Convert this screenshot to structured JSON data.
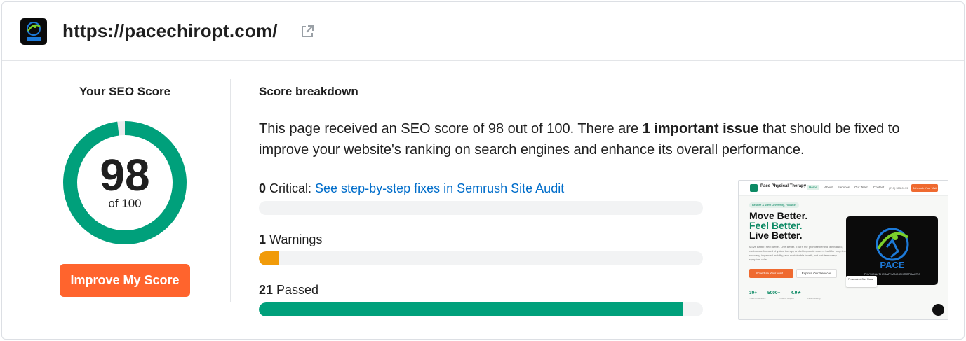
{
  "site": {
    "url": "https://pacechiropt.com/"
  },
  "score_panel": {
    "title": "Your SEO Score",
    "score": 98,
    "score_text": "98",
    "out_of_text": "of 100",
    "max": 100,
    "improve_button": "Improve My Score",
    "ring_color": "#00a07b",
    "button_color": "#ff642d"
  },
  "breakdown": {
    "title": "Score breakdown",
    "summary": {
      "pre": "This page received an SEO score of 98 out of 100. There are ",
      "bold": "1 important issue",
      "post": " that should be fixed to improve your website's ranking on search engines and enhance its overall performance."
    },
    "metrics": [
      {
        "count": "0",
        "label": " Critical: ",
        "link": "See step-by-step fixes in Semrush Site Audit",
        "fill_fraction": 0.0,
        "color": "#e5483b"
      },
      {
        "count": "1",
        "label": " Warnings",
        "link": "",
        "fill_fraction": 0.045,
        "color": "#f19b09"
      },
      {
        "count": "21",
        "label": " Passed",
        "link": "",
        "fill_fraction": 0.955,
        "color": "#00a07b"
      }
    ]
  },
  "thumbnail": {
    "brand": "Pace Physical Therapy",
    "nav": [
      "Home",
      "About",
      "Services",
      "Our Team",
      "Contact"
    ],
    "phone": "(713) 555-0199",
    "cta": "Schedule Your Visit",
    "pill": "Bellaire & West University, Houston",
    "headline": [
      "Move Better.",
      "Feel Better.",
      "Live Better."
    ],
    "paragraph": "Move Better. Feel Better. Live Better. That's the promise behind our holistic, root-cause focused physical therapy and chiropractic care — built for long-term recovery, improved mobility, and sustainable health, not just temporary symptom relief.",
    "button_primary": "Schedule Your Visit →",
    "button_secondary": "Explore Our Services",
    "stats": [
      "30+",
      "5000+",
      "4.9★"
    ],
    "stat_labels": [
      "Years Experience",
      "Patients Helped",
      "Patient Rating"
    ],
    "care_card": "Personalized Care Plans",
    "logo_text": "PACE",
    "logo_sub": "PHYSICAL THERAPY AND CHIROPRACTIC"
  }
}
